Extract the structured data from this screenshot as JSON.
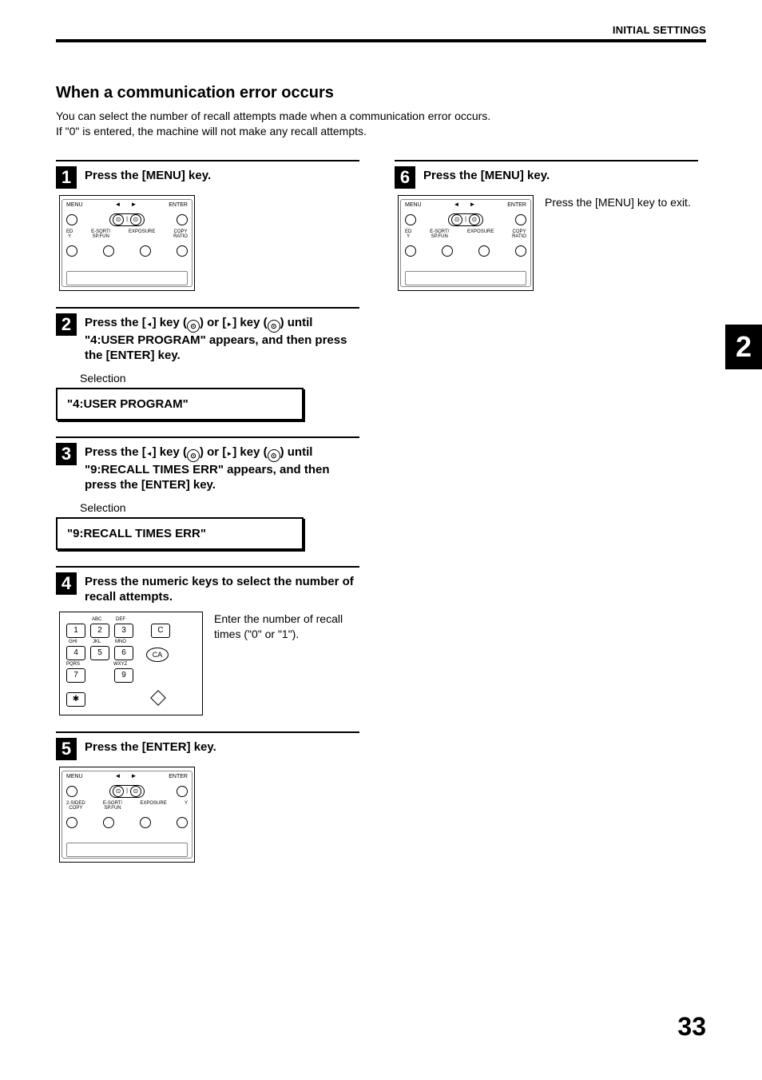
{
  "header": {
    "breadcrumb": "INITIAL SETTINGS"
  },
  "section": {
    "title": "When a communication error occurs",
    "intro_l1": "You can select the number of recall attempts made when a communication error occurs.",
    "intro_l2": "If \"0\" is entered, the machine will not make any recall attempts."
  },
  "steps": {
    "s1": {
      "num": "1",
      "title": "Press the [MENU] key."
    },
    "s2": {
      "num": "2",
      "title_pre": "Press the [",
      "title_mid1": "] key (",
      "title_mid2": ") or [",
      "title_mid3": "] key (",
      "title_post": ") until \"4:USER PROGRAM\" appears, and then press the [ENTER] key.",
      "sel_label": "Selection",
      "display": "\"4:USER PROGRAM\""
    },
    "s3": {
      "num": "3",
      "title_pre": "Press the [",
      "title_mid1": "] key (",
      "title_mid2": ") or [",
      "title_mid3": "] key (",
      "title_post": ") until \"9:RECALL TIMES ERR\" appears, and then press the [ENTER] key.",
      "sel_label": "Selection",
      "display": "\"9:RECALL TIMES ERR\""
    },
    "s4": {
      "num": "4",
      "title": "Press the numeric keys to select the number of recall attempts.",
      "note": "Enter the number of recall times (\"0\" or \"1\")."
    },
    "s5": {
      "num": "5",
      "title": "Press the [ENTER] key."
    },
    "s6": {
      "num": "6",
      "title": "Press the [MENU] key.",
      "note": "Press the [MENU] key to exit."
    }
  },
  "panel_labels": {
    "menu": "MENU",
    "enter": "ENTER",
    "twosided": "2-SIDED",
    "copy": "COPY",
    "esort": "E-SORT/",
    "spfun": "SP.FUN",
    "exposure": "EXPOSURE",
    "ratio": "RATIO",
    "ed": "ED",
    "y": "Y"
  },
  "keypad_labels": {
    "abc": "ABC",
    "def": "DEF",
    "ghi": "GHI",
    "jkl": "JKL",
    "mno": "MNO",
    "pqrs": "PQRS",
    "wxyz": "WXYZ",
    "c": "C",
    "ca": "CA",
    "k1": "1",
    "k2": "2",
    "k3": "3",
    "k4": "4",
    "k5": "5",
    "k6": "6",
    "k7": "7",
    "k9": "9",
    "star": "✱"
  },
  "side_tab": "2",
  "page_number": "33"
}
